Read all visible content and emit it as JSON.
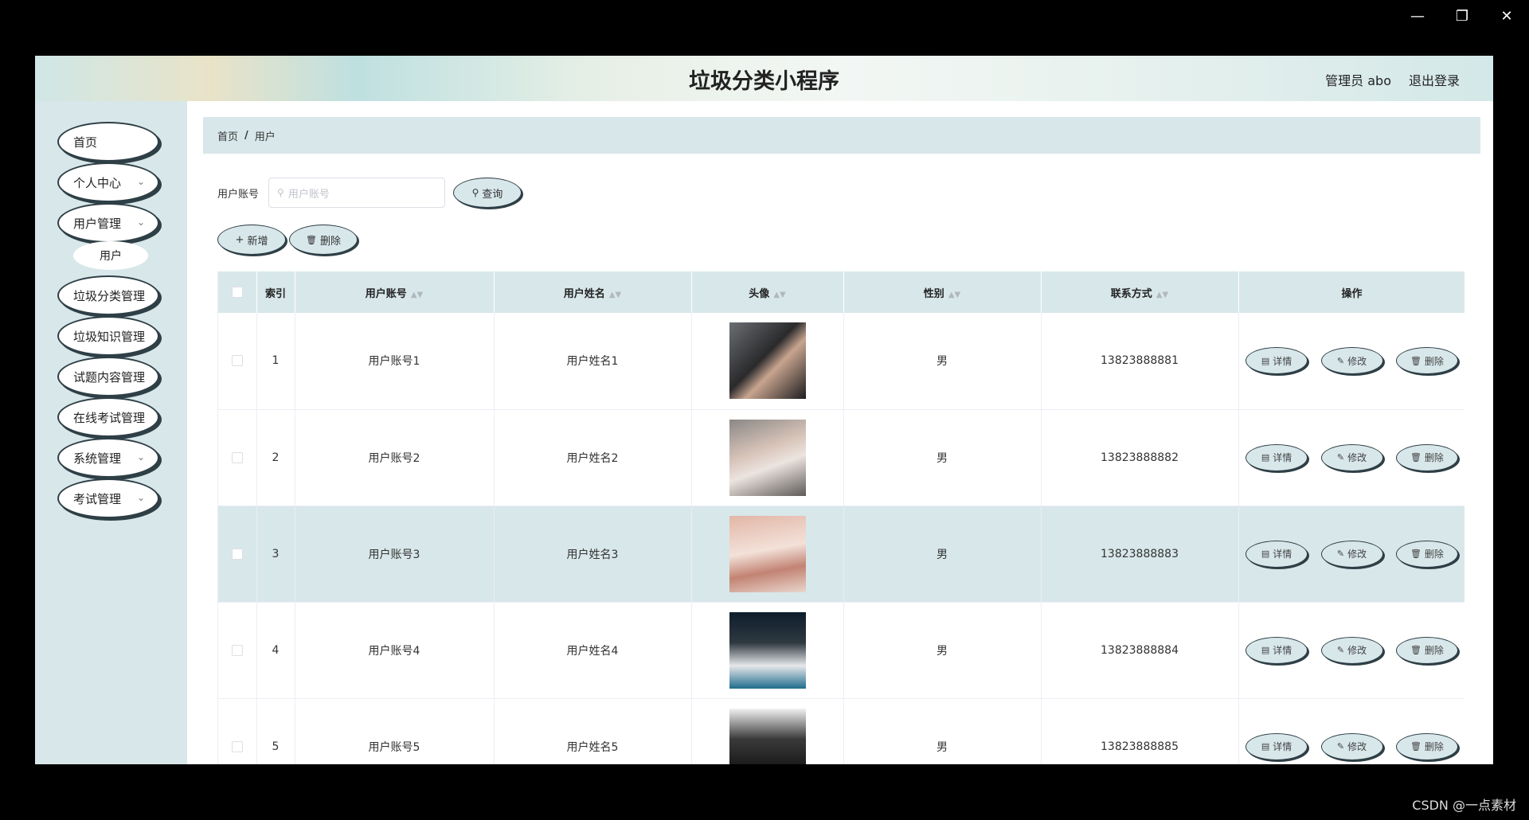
{
  "window": {
    "minimize_icon": "minimize-icon",
    "restore_icon": "restore-icon",
    "close_icon": "close-icon"
  },
  "header": {
    "title": "垃圾分类小程序",
    "user": "管理员 abo",
    "logout": "退出登录"
  },
  "sidebar": {
    "items": [
      {
        "label": "首页",
        "has_children": false
      },
      {
        "label": "个人中心",
        "has_children": true
      },
      {
        "label": "用户管理",
        "has_children": true
      },
      {
        "label": "垃圾分类管理",
        "has_children": false
      },
      {
        "label": "垃圾知识管理",
        "has_children": false
      },
      {
        "label": "试题内容管理",
        "has_children": false
      },
      {
        "label": "在线考试管理",
        "has_children": false
      },
      {
        "label": "系统管理",
        "has_children": true
      },
      {
        "label": "考试管理",
        "has_children": true
      }
    ],
    "subitem": "用户"
  },
  "breadcrumb": {
    "home": "首页",
    "sep": "/",
    "current": "用户"
  },
  "search": {
    "label": "用户账号",
    "placeholder": "用户账号",
    "button": "查询"
  },
  "actions": {
    "add": "新增",
    "delete": "删除"
  },
  "table": {
    "headers": {
      "index": "索引",
      "account": "用户账号",
      "name": "用户姓名",
      "avatar": "头像",
      "gender": "性别",
      "phone": "联系方式",
      "ops": "操作"
    },
    "ops": {
      "detail": "详情",
      "edit": "修改",
      "delete": "删除"
    },
    "rows": [
      {
        "index": "1",
        "account": "用户账号1",
        "name": "用户姓名1",
        "gender": "男",
        "phone": "13823888881"
      },
      {
        "index": "2",
        "account": "用户账号2",
        "name": "用户姓名2",
        "gender": "男",
        "phone": "13823888882"
      },
      {
        "index": "3",
        "account": "用户账号3",
        "name": "用户姓名3",
        "gender": "男",
        "phone": "13823888883"
      },
      {
        "index": "4",
        "account": "用户账号4",
        "name": "用户姓名4",
        "gender": "男",
        "phone": "13823888884"
      },
      {
        "index": "5",
        "account": "用户账号5",
        "name": "用户姓名5",
        "gender": "男",
        "phone": "13823888885"
      }
    ],
    "highlighted_row": 3
  },
  "watermark": "CSDN @一点素材",
  "colors": {
    "accent": "#d8e7ea",
    "border": "#2e3f46"
  }
}
